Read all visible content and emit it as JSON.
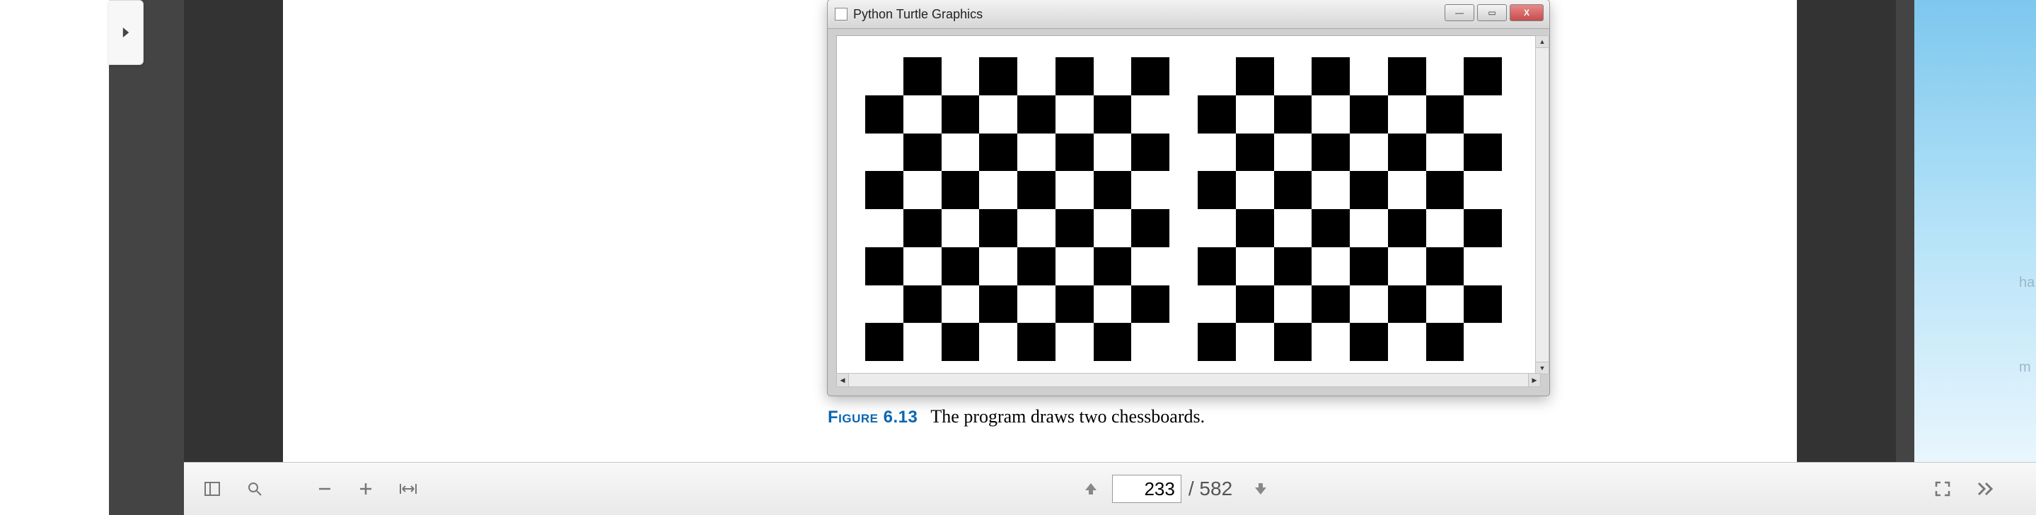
{
  "window": {
    "title": "Python Turtle Graphics"
  },
  "figure": {
    "label": "Figure 6.13",
    "caption": "The program draws two chessboards."
  },
  "toolbar": {
    "page_current": "233",
    "page_total": "/ 582"
  },
  "side_text": {
    "ha": "ha",
    "m": "m"
  },
  "chessboard": {
    "size": 8
  }
}
